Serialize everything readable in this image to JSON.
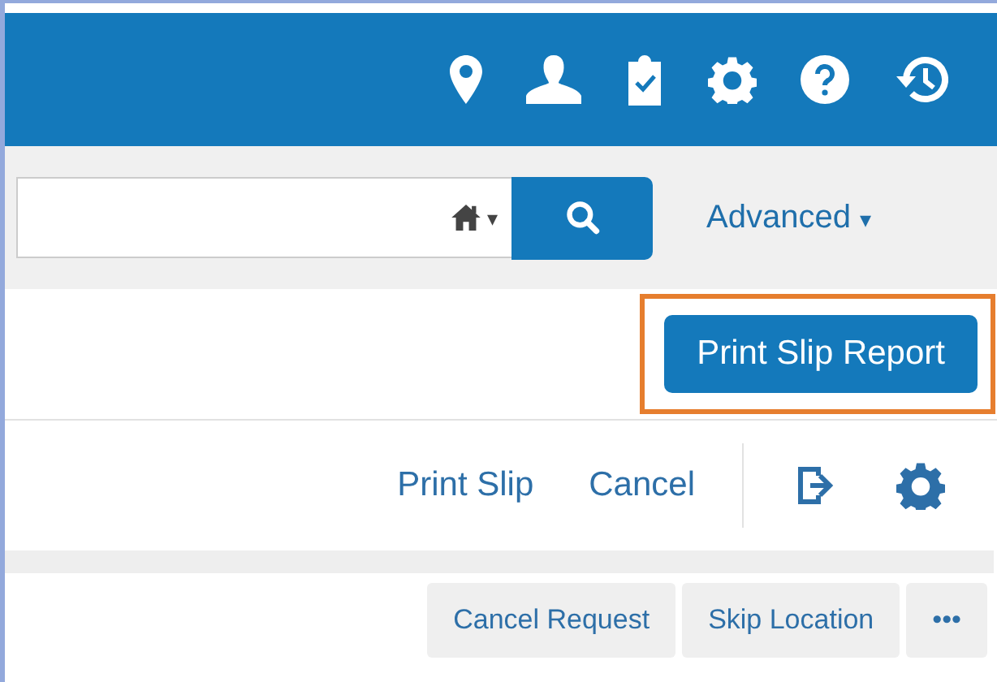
{
  "search": {
    "scope_caret": "▾"
  },
  "advanced": {
    "label": "Advanced",
    "caret": "▾"
  },
  "report_button": {
    "label": "Print Slip Report",
    "highlighted": true
  },
  "actions": [
    {
      "label": "Print Slip"
    },
    {
      "label": "Cancel"
    }
  ],
  "row_buttons": [
    {
      "label": "Cancel Request"
    },
    {
      "label": "Skip Location"
    },
    {
      "label": "•••"
    }
  ]
}
